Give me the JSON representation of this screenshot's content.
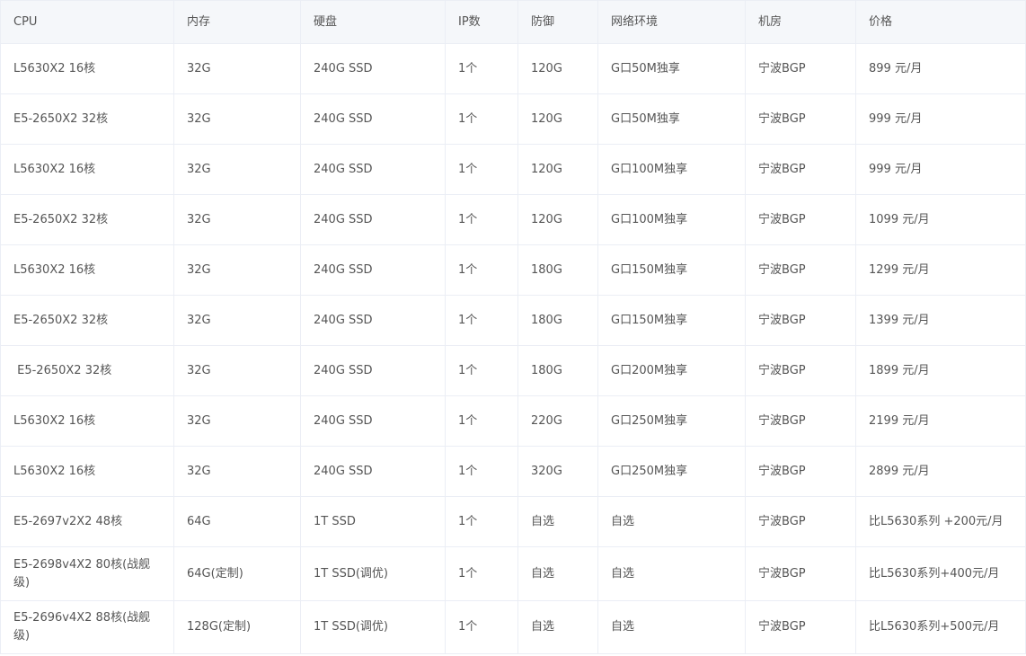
{
  "table": {
    "headers": [
      "CPU",
      "内存",
      "硬盘",
      "IP数",
      "防御",
      "网络环境",
      "机房",
      "价格"
    ],
    "rows": [
      [
        "L5630X2 16核",
        "32G",
        "240G SSD",
        "1个",
        "120G",
        "G口50M独享",
        "宁波BGP",
        "899 元/月"
      ],
      [
        "E5-2650X2 32核",
        "32G",
        "240G SSD",
        "1个",
        "120G",
        "G口50M独享",
        "宁波BGP",
        "999 元/月"
      ],
      [
        "L5630X2 16核",
        "32G",
        "240G SSD",
        "1个",
        "120G",
        "G口100M独享",
        "宁波BGP",
        "999 元/月"
      ],
      [
        "E5-2650X2 32核",
        "32G",
        "240G SSD",
        "1个",
        "120G",
        "G口100M独享",
        "宁波BGP",
        "1099 元/月"
      ],
      [
        "L5630X2 16核",
        "32G",
        "240G SSD",
        "1个",
        "180G",
        "G口150M独享",
        "宁波BGP",
        "1299 元/月"
      ],
      [
        "E5-2650X2 32核",
        "32G",
        "240G SSD",
        "1个",
        "180G",
        "G口150M独享",
        "宁波BGP",
        "1399 元/月"
      ],
      [
        " E5-2650X2 32核",
        "32G",
        "240G SSD",
        "1个",
        "180G",
        "G口200M独享",
        "宁波BGP",
        "1899 元/月"
      ],
      [
        "L5630X2 16核",
        "32G",
        "240G SSD",
        "1个",
        "220G",
        "G口250M独享",
        "宁波BGP",
        "2199 元/月"
      ],
      [
        "L5630X2 16核",
        "32G",
        "240G SSD",
        "1个",
        "320G",
        "G口250M独享",
        "宁波BGP",
        "2899 元/月"
      ],
      [
        "E5-2697v2X2 48核",
        "64G",
        "1T SSD",
        "1个",
        "自选",
        "自选",
        "宁波BGP",
        "比L5630系列 +200元/月"
      ],
      [
        "E5-2698v4X2 80核(战舰级)",
        "64G(定制)",
        "1T SSD(调优)",
        "1个",
        "自选",
        "自选",
        "宁波BGP",
        "比L5630系列+400元/月"
      ],
      [
        "E5-2696v4X2 88核(战舰级)",
        "128G(定制)",
        "1T SSD(调优)",
        "1个",
        "自选",
        "自选",
        "宁波BGP",
        "比L5630系列+500元/月"
      ]
    ]
  }
}
